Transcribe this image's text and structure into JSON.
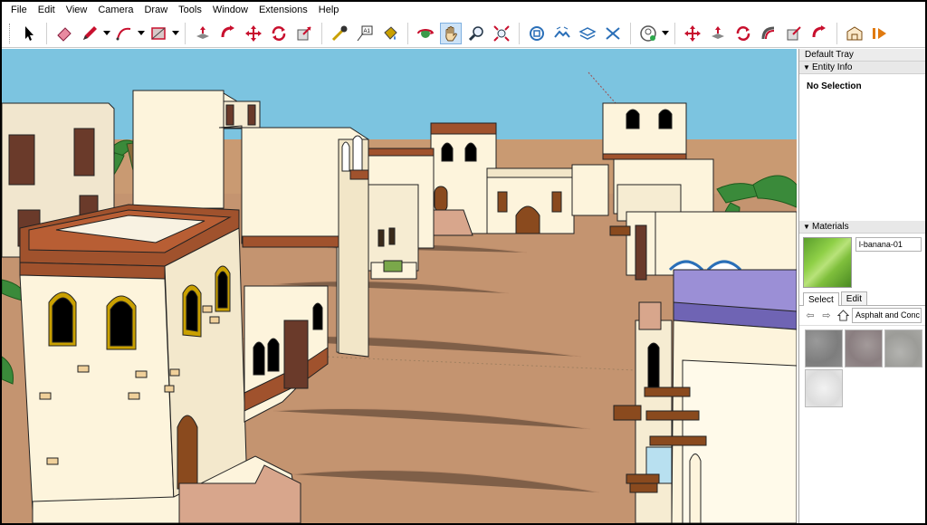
{
  "menu": [
    "File",
    "Edit",
    "View",
    "Camera",
    "Draw",
    "Tools",
    "Window",
    "Extensions",
    "Help"
  ],
  "toolbar": {
    "groups": [
      [
        "select-icon"
      ],
      [
        "eraser-icon",
        "pencil-icon",
        "arc-icon",
        "rectangle-icon"
      ],
      [
        "push-pull-icon",
        "follow-me-icon",
        "move-icon",
        "rotate-icon",
        "scale-icon"
      ],
      [
        "tape-measure-icon",
        "text-icon",
        "paint-bucket-icon"
      ],
      [
        "orbit-icon",
        "pan-icon",
        "zoom-icon",
        "zoom-extents-icon"
      ],
      [
        "component-icon",
        "terrain-icon",
        "layers-icon",
        "section-icon"
      ],
      [
        "user-icon"
      ],
      [
        "move-tool-icon",
        "push-pull-tool-icon",
        "rotate-tool-icon",
        "orbit-tool-icon",
        "scale-tool-icon",
        "follow-tool-icon"
      ],
      [
        "warehouse-icon",
        "extension-icon"
      ]
    ],
    "active": "pan-icon"
  },
  "tray": {
    "title": "Default Tray",
    "entity_info": {
      "header": "Entity Info",
      "selection": "No Selection"
    },
    "materials": {
      "header": "Materials",
      "current_name": "l-banana-01",
      "tabs": [
        "Select",
        "Edit"
      ],
      "selected_tab": "Select",
      "library": "Asphalt and Conc"
    }
  },
  "colors": {
    "sky": "#7cc4e0",
    "sand": "#c49470",
    "wall": "#fdf4dc",
    "brick": "#a0522d",
    "roof_purple": "#9b8fd6",
    "accent_red": "#c8102e"
  }
}
